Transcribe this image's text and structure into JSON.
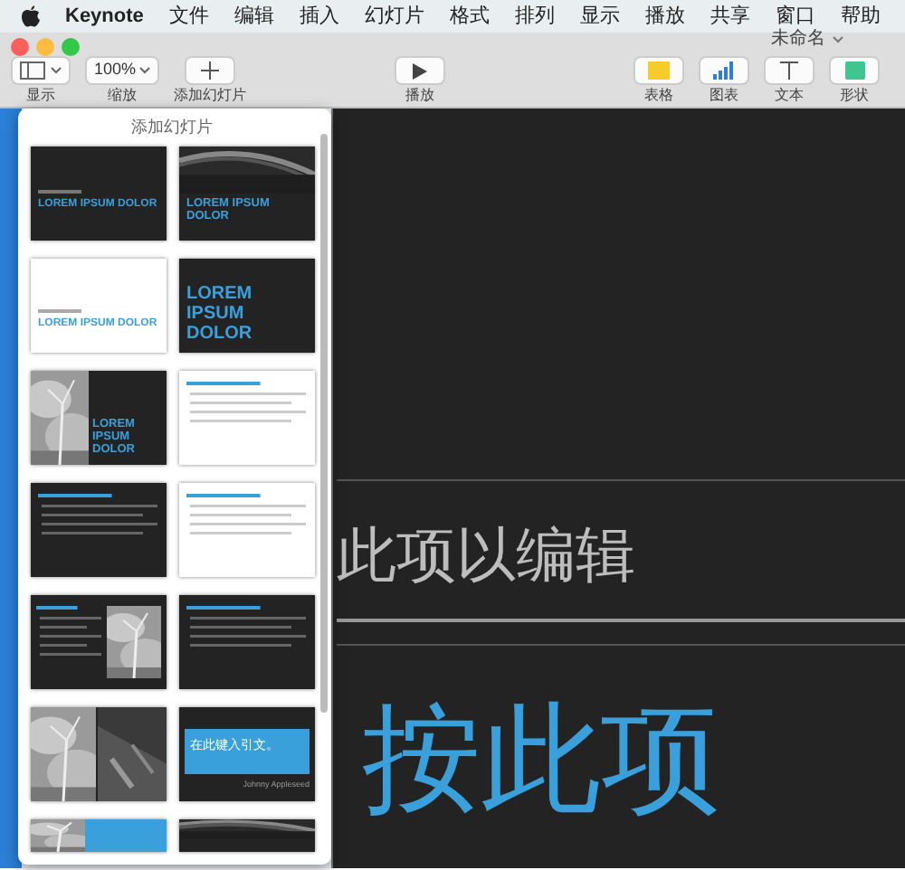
{
  "menu_bar": {
    "app": "Keynote",
    "items": [
      "文件",
      "编辑",
      "插入",
      "幻灯片",
      "格式",
      "排列",
      "显示",
      "播放",
      "共享",
      "窗口",
      "帮助"
    ]
  },
  "window": {
    "title": "未命名"
  },
  "toolbar": {
    "left": [
      {
        "kind": "view",
        "label": "显示"
      },
      {
        "kind": "zoom",
        "value": "100%",
        "label": "缩放"
      },
      {
        "kind": "add",
        "label": "添加幻灯片"
      }
    ],
    "center": [
      {
        "kind": "play",
        "label": "播放"
      }
    ],
    "right": [
      {
        "kind": "table",
        "label": "表格"
      },
      {
        "kind": "chart",
        "label": "图表"
      },
      {
        "kind": "text",
        "label": "文本"
      },
      {
        "kind": "shape",
        "label": "形状"
      }
    ]
  },
  "popover": {
    "title": "添加幻灯片",
    "slides": [
      {
        "kind": "title-dark",
        "title": "LOREM IPSUM DOLOR"
      },
      {
        "kind": "title-arc",
        "title": "LOREM IPSUM DOLOR"
      },
      {
        "kind": "title-light",
        "title": "LOREM IPSUM DOLOR"
      },
      {
        "kind": "title-big",
        "title": "LOREM IPSUM DOLOR"
      },
      {
        "kind": "photo-title",
        "title": "LOREM IPSUM DOLOR"
      },
      {
        "kind": "bullets-light"
      },
      {
        "kind": "bullets-dark"
      },
      {
        "kind": "bullets-light"
      },
      {
        "kind": "photo-bullets"
      },
      {
        "kind": "bullets-dark"
      },
      {
        "kind": "photos"
      },
      {
        "kind": "quote",
        "quote": "在此键入引文。",
        "author": "Johnny Appleseed"
      },
      {
        "kind": "photo-blue"
      },
      {
        "kind": "arc"
      }
    ]
  },
  "canvas": {
    "subtitle": "此项以编辑",
    "title": "按此项"
  }
}
